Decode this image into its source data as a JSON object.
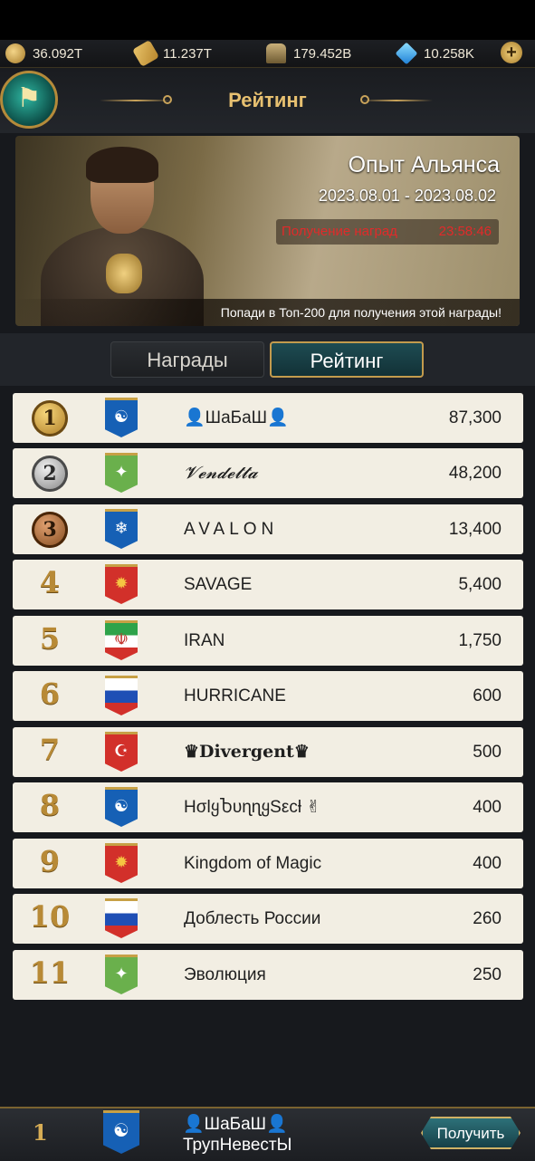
{
  "resources": [
    {
      "icon": "coin-icon",
      "value": "36.092T"
    },
    {
      "icon": "grain-icon",
      "value": "11.237T"
    },
    {
      "icon": "helmet-icon",
      "value": "179.452B"
    },
    {
      "icon": "gem-icon",
      "value": "10.258K"
    }
  ],
  "header": {
    "title": "Рейтинг",
    "add_label": "+"
  },
  "banner": {
    "title": "Опыт Альянса",
    "dates": "2023.08.01  - 2023.08.02",
    "reward_label": "Получение наград",
    "countdown": "23:58:46",
    "footer": "Попади в Топ-200 для получения этой награды!"
  },
  "tabs": [
    {
      "label": "Награды",
      "active": false
    },
    {
      "label": "Рейтинг",
      "active": true
    }
  ],
  "rankings": [
    {
      "rank": "1",
      "flag": "yin-yang-blue",
      "name": "👤ШаБаШ👤",
      "score": "87,300"
    },
    {
      "rank": "2",
      "flag": "eagle-green",
      "name": "𝓥𝓮𝓷𝓭𝓮𝓽𝓽𝓪",
      "score": "48,200"
    },
    {
      "rank": "3",
      "flag": "snowflake-blue",
      "name": "AVALON",
      "score": "13,400"
    },
    {
      "rank": "4",
      "flag": "sun-red",
      "name": "SAVAGE",
      "score": "5,400"
    },
    {
      "rank": "5",
      "flag": "iran",
      "name": "IRAN",
      "score": "1,750"
    },
    {
      "rank": "6",
      "flag": "russia",
      "name": "HURRICANE",
      "score": "600"
    },
    {
      "rank": "7",
      "flag": "turkey",
      "name": "♛Divergent♛",
      "score": "500"
    },
    {
      "rank": "8",
      "flag": "yin-yang-blue",
      "name": "HσlყႦυɳɳყSεcƚ ✌",
      "score": "400"
    },
    {
      "rank": "9",
      "flag": "sun-red",
      "name": "Kingdom of Magic",
      "score": "400"
    },
    {
      "rank": "10",
      "flag": "russia",
      "name": "Доблесть России",
      "score": "260"
    },
    {
      "rank": "11",
      "flag": "eagle-green",
      "name": "Эволюция",
      "score": "250"
    }
  ],
  "my_rank": {
    "rank": "1",
    "flag": "yin-yang-blue",
    "name": "👤ШаБаШ👤",
    "subtitle": "ТрупНевестЫ",
    "claim_label": "Получить"
  }
}
